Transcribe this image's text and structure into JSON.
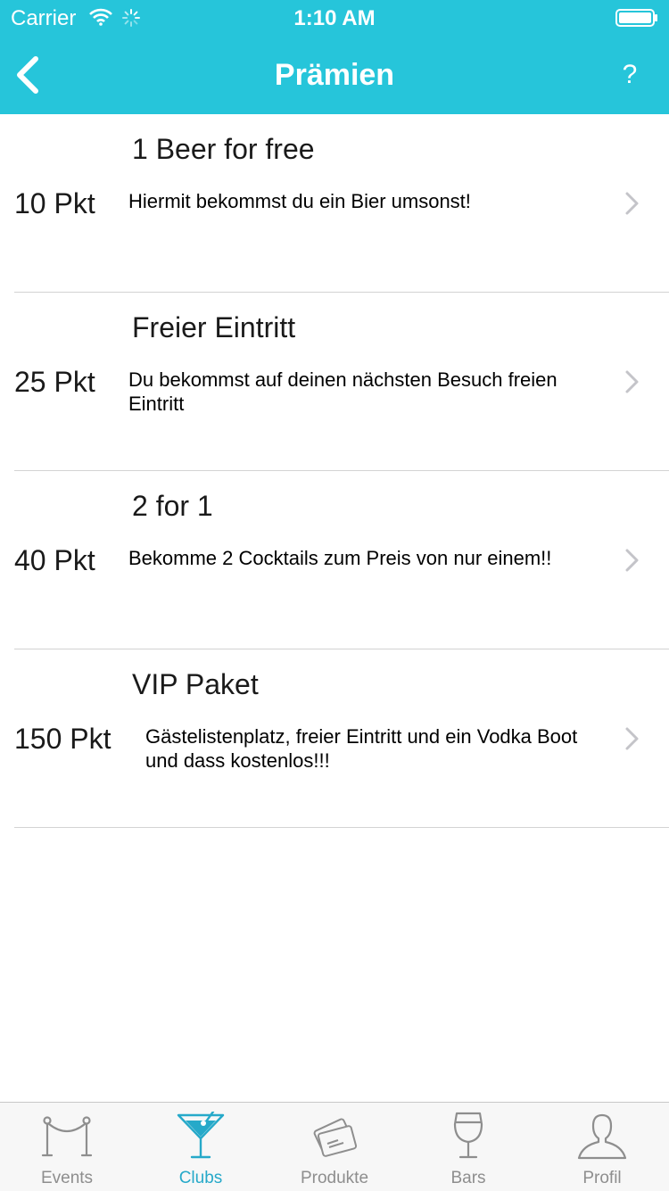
{
  "status_bar": {
    "carrier": "Carrier",
    "time": "1:10 AM"
  },
  "nav": {
    "title": "Prämien",
    "help_label": "?"
  },
  "rewards": [
    {
      "title": "1 Beer for free",
      "points": "10 Pkt",
      "description": "Hiermit bekommst du ein Bier umsonst!"
    },
    {
      "title": "Freier Eintritt",
      "points": "25 Pkt",
      "description": "Du bekommst auf deinen nächsten Besuch freien Eintritt"
    },
    {
      "title": "2 for 1",
      "points": "40 Pkt",
      "description": "Bekomme 2 Cocktails zum Preis von nur einem!!"
    },
    {
      "title": "VIP Paket",
      "points": "150 Pkt",
      "description": "Gästelistenplatz, freier Eintritt und ein Vodka Boot und dass kostenlos!!!"
    }
  ],
  "tabs": [
    {
      "label": "Events",
      "icon": "velvet-rope-icon",
      "active": false
    },
    {
      "label": "Clubs",
      "icon": "cocktail-glass-icon",
      "active": true
    },
    {
      "label": "Produkte",
      "icon": "tickets-icon",
      "active": false
    },
    {
      "label": "Bars",
      "icon": "wine-glass-icon",
      "active": false
    },
    {
      "label": "Profil",
      "icon": "person-icon",
      "active": false
    }
  ],
  "colors": {
    "accent": "#26c5da",
    "tab_active": "#26a9c9",
    "tab_inactive": "#8e8e8e",
    "separator": "#d3d3d3"
  }
}
